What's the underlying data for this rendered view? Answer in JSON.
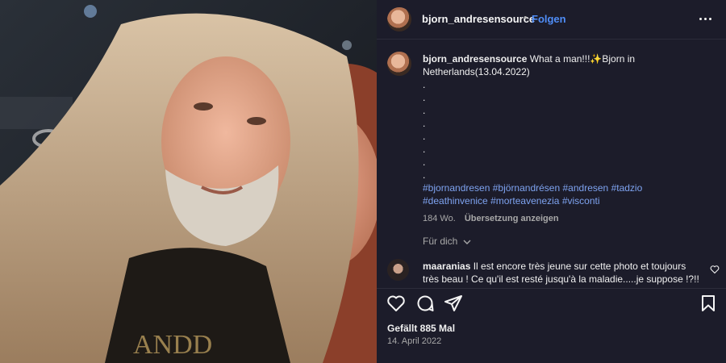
{
  "post": {
    "username": "bjorn_andresensource",
    "separator": "•",
    "follow_label": "Folgen",
    "more_icon": "more-horizontal-icon"
  },
  "caption": {
    "username": "bjorn_andresensource",
    "text": "What a man!!!✨Bjorn in Netherlands(13.04.2022)",
    "dots": [
      ".",
      ".",
      ".",
      ".",
      ".",
      ".",
      ".",
      "."
    ],
    "hashtags": [
      "#bjornandresen",
      "#björnandrésen",
      "#andresen",
      "#tadzio",
      "#deathinvenice",
      "#morteavenezia",
      "#visconti"
    ],
    "age": "184 Wo.",
    "translate_label": "Übersetzung anzeigen"
  },
  "showfor_label": "Für dich",
  "comment": {
    "username": "maaranias",
    "text": "Il est encore très jeune sur cette photo et toujours très beau ! Ce qu'il est resté jusqu'à la maladie.....je suppose !?!!"
  },
  "actions": {
    "like_icon": "heart-icon",
    "comment_icon": "comment-icon",
    "share_icon": "share-icon",
    "save_icon": "bookmark-icon"
  },
  "likes_text": "Gefällt 885 Mal",
  "date_text": "14. April 2022",
  "colors": {
    "background": "#1c1c2a",
    "accent": "#4f8df7",
    "hashtag": "#7ea3f0",
    "muted": "#a8a8a8"
  }
}
